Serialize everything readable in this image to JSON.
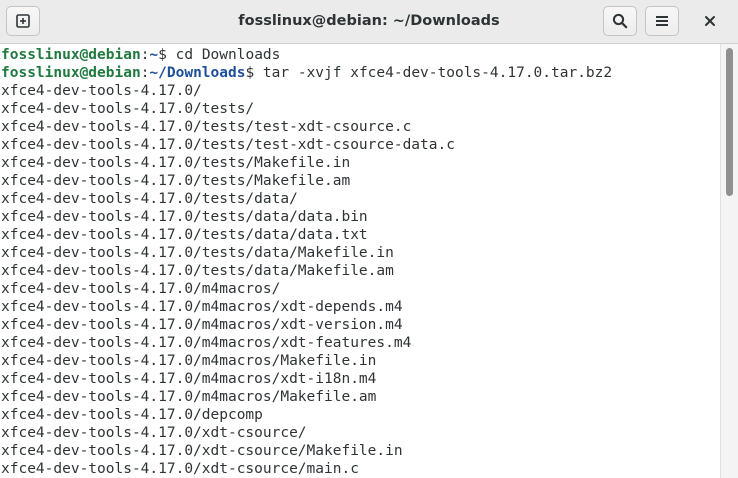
{
  "window": {
    "title": "fosslinux@debian: ~/Downloads"
  },
  "toolbar": {
    "new_tab_icon": "new-tab-icon",
    "search_icon": "search-icon",
    "menu_icon": "hamburger-menu-icon",
    "close_icon": "close-icon"
  },
  "terminal": {
    "prompts": [
      {
        "user": "fosslinux@debian",
        "sep": ":",
        "path": "~",
        "symbol": "$ ",
        "command": "cd Downloads"
      },
      {
        "user": "fosslinux@debian",
        "sep": ":",
        "path": "~/Downloads",
        "symbol": "$ ",
        "command": "tar -xvjf xfce4-dev-tools-4.17.0.tar.bz2"
      }
    ],
    "output": [
      "xfce4-dev-tools-4.17.0/",
      "xfce4-dev-tools-4.17.0/tests/",
      "xfce4-dev-tools-4.17.0/tests/test-xdt-csource.c",
      "xfce4-dev-tools-4.17.0/tests/test-xdt-csource-data.c",
      "xfce4-dev-tools-4.17.0/tests/Makefile.in",
      "xfce4-dev-tools-4.17.0/tests/Makefile.am",
      "xfce4-dev-tools-4.17.0/tests/data/",
      "xfce4-dev-tools-4.17.0/tests/data/data.bin",
      "xfce4-dev-tools-4.17.0/tests/data/data.txt",
      "xfce4-dev-tools-4.17.0/tests/data/Makefile.in",
      "xfce4-dev-tools-4.17.0/tests/data/Makefile.am",
      "xfce4-dev-tools-4.17.0/m4macros/",
      "xfce4-dev-tools-4.17.0/m4macros/xdt-depends.m4",
      "xfce4-dev-tools-4.17.0/m4macros/xdt-version.m4",
      "xfce4-dev-tools-4.17.0/m4macros/xdt-features.m4",
      "xfce4-dev-tools-4.17.0/m4macros/Makefile.in",
      "xfce4-dev-tools-4.17.0/m4macros/xdt-i18n.m4",
      "xfce4-dev-tools-4.17.0/m4macros/Makefile.am",
      "xfce4-dev-tools-4.17.0/depcomp",
      "xfce4-dev-tools-4.17.0/xdt-csource/",
      "xfce4-dev-tools-4.17.0/xdt-csource/Makefile.in",
      "xfce4-dev-tools-4.17.0/xdt-csource/main.c"
    ]
  },
  "colors": {
    "prompt_user": "#1f7a3f",
    "prompt_path": "#1e4f9a",
    "text": "#2e3436",
    "titlebar": "#ebebeb"
  }
}
